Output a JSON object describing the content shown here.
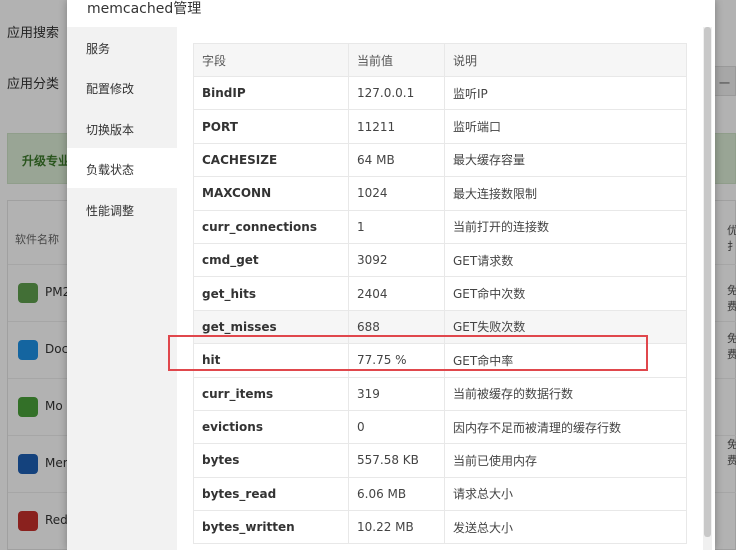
{
  "background": {
    "nav": [
      "应用搜索",
      "应用分类"
    ],
    "banner_text": "升级专业",
    "right_button": "一",
    "table_header": "软件名称",
    "rows": [
      {
        "name": "PM2",
        "icon": "nodejs-icon",
        "color": "#5fa04e"
      },
      {
        "name": "Doc",
        "icon": "docker-icon",
        "color": "#1d91e6"
      },
      {
        "name": "Mo",
        "icon": "mongodb-icon",
        "color": "#4aa13a"
      },
      {
        "name": "Mem",
        "icon": "memcached-icon",
        "color": "#1e5fb4"
      },
      {
        "name": "Red",
        "icon": "redis-icon",
        "color": "#c6302b"
      }
    ],
    "right_texts": [
      "优",
      "扌",
      "免",
      "费",
      "免",
      "费",
      "免",
      "费"
    ]
  },
  "modal": {
    "title": "memcached管理",
    "sidebar": [
      {
        "label": "服务",
        "active": false
      },
      {
        "label": "配置修改",
        "active": false
      },
      {
        "label": "切换版本",
        "active": false
      },
      {
        "label": "负载状态",
        "active": true
      },
      {
        "label": "性能调整",
        "active": false
      }
    ],
    "table": {
      "headers": [
        "字段",
        "当前值",
        "说明"
      ],
      "rows": [
        {
          "field": "BindIP",
          "value": "127.0.0.1",
          "desc": "监听IP"
        },
        {
          "field": "PORT",
          "value": "11211",
          "desc": "监听端口"
        },
        {
          "field": "CACHESIZE",
          "value": "64 MB",
          "desc": "最大缓存容量"
        },
        {
          "field": "MAXCONN",
          "value": "1024",
          "desc": "最大连接数限制"
        },
        {
          "field": "curr_connections",
          "value": "1",
          "desc": "当前打开的连接数"
        },
        {
          "field": "cmd_get",
          "value": "3092",
          "desc": "GET请求数"
        },
        {
          "field": "get_hits",
          "value": "2404",
          "desc": "GET命中次数"
        },
        {
          "field": "get_misses",
          "value": "688",
          "desc": "GET失败次数"
        },
        {
          "field": "hit",
          "value": "77.75 %",
          "desc": "GET命中率"
        },
        {
          "field": "curr_items",
          "value": "319",
          "desc": "当前被缓存的数据行数"
        },
        {
          "field": "evictions",
          "value": "0",
          "desc": "因内存不足而被清理的缓存行数"
        },
        {
          "field": "bytes",
          "value": "557.58 KB",
          "desc": "当前已使用内存"
        },
        {
          "field": "bytes_read",
          "value": "6.06 MB",
          "desc": "请求总大小"
        },
        {
          "field": "bytes_written",
          "value": "10.22 MB",
          "desc": "发送总大小"
        }
      ]
    }
  },
  "colors": {
    "highlight": "#e0474c",
    "banner": "#dcecd6"
  }
}
